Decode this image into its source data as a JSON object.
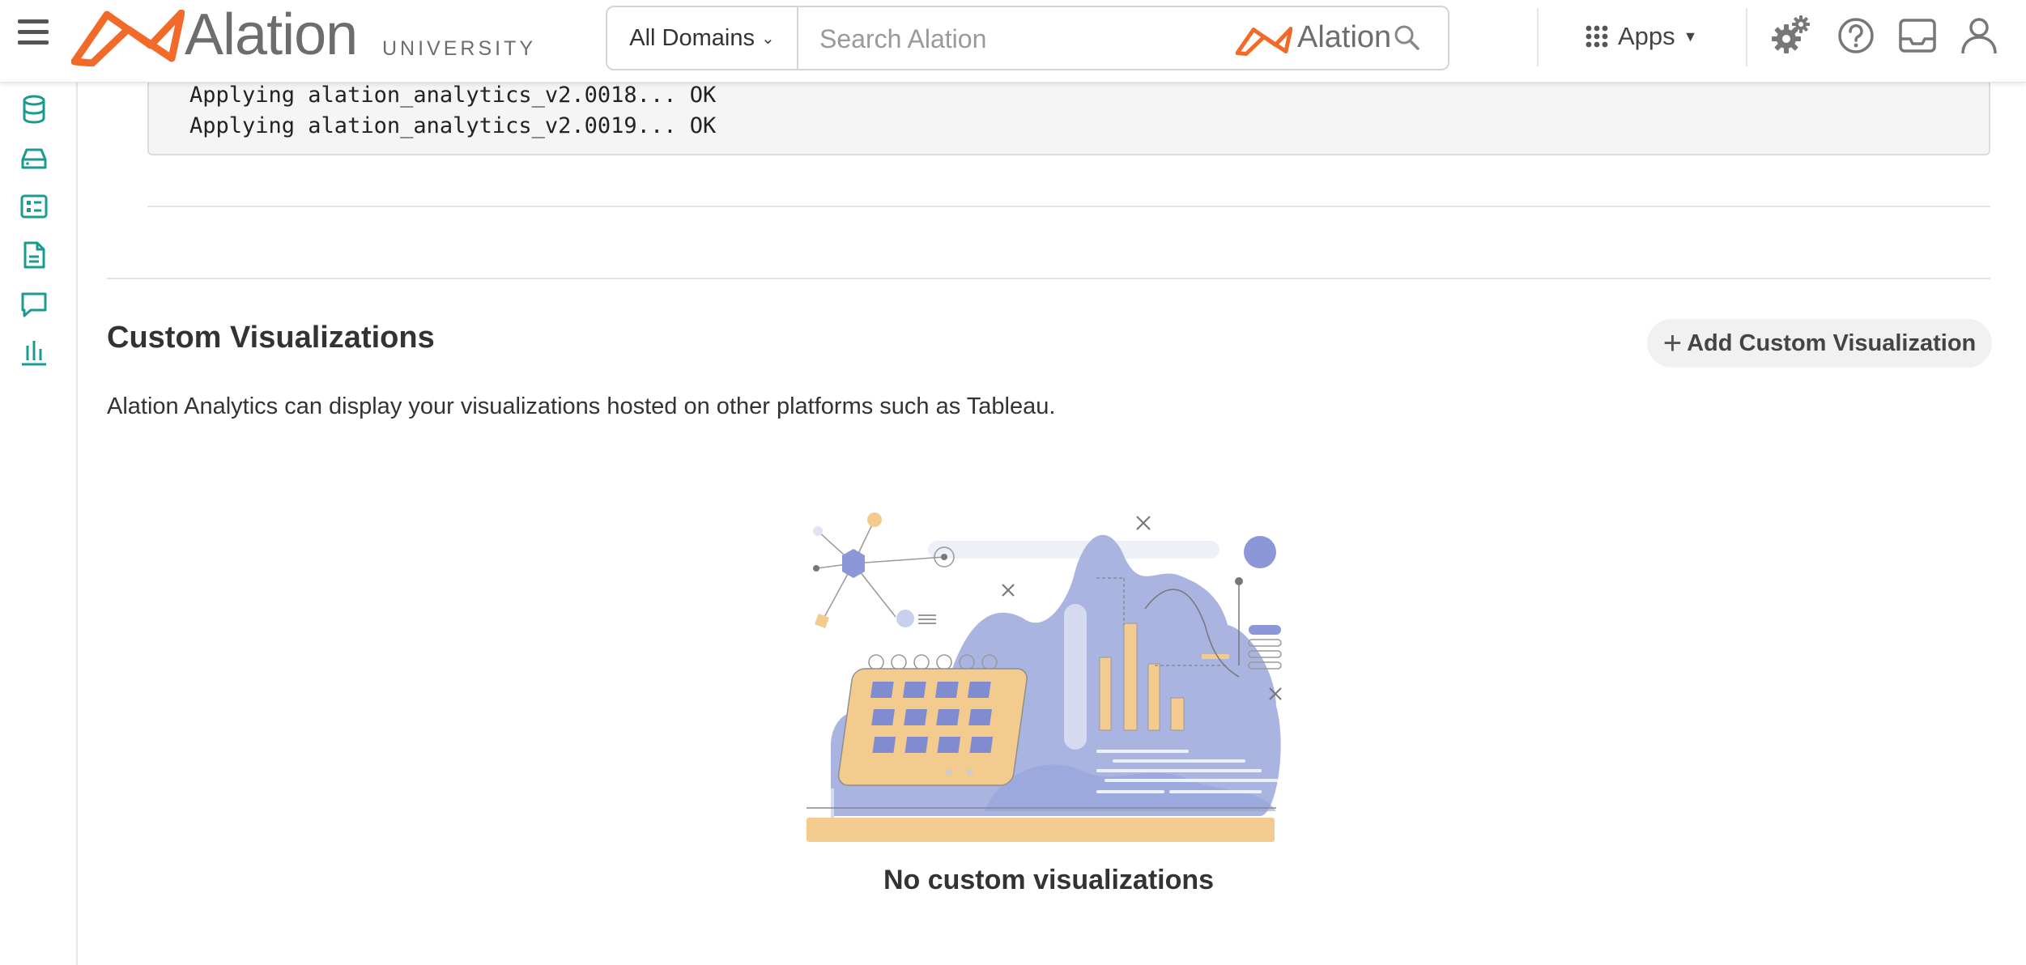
{
  "header": {
    "logo_text": "Alation",
    "logo_subtext": "UNIVERSITY",
    "domain_select": "All Domains",
    "search_placeholder": "Search Alation",
    "search_brand": "Alation",
    "apps_label": "Apps"
  },
  "sidebar": {
    "items": [
      "database-icon",
      "storage-drive-icon",
      "catalog-list-icon",
      "document-icon",
      "conversation-icon",
      "analytics-chart-icon"
    ]
  },
  "code_output": {
    "lines": [
      "Applying alation_analytics_v2.0018... OK",
      "Applying alation_analytics_v2.0019... OK"
    ]
  },
  "custom_visualizations": {
    "title": "Custom Visualizations",
    "add_button": "Add Custom Visualization",
    "description": "Alation Analytics can display your visualizations hosted on other platforms such as Tableau.",
    "empty_message": "No custom visualizations"
  },
  "colors": {
    "brand_orange": "#f26a2a",
    "sidebar_teal": "#1a9b8f",
    "illustration_blue": "#9fabd9",
    "illustration_yellow": "#f3cb8e"
  }
}
